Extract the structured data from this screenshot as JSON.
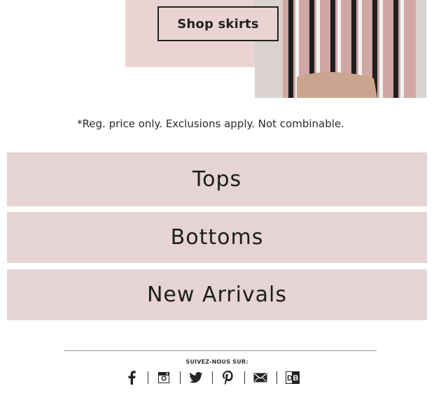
{
  "hero": {
    "button_label": "Shop skirts",
    "panel_color": "#ead4d3"
  },
  "disclaimer": "*Reg. price only. Exclusions apply. Not combinable.",
  "categories": [
    {
      "label": "Tops"
    },
    {
      "label": "Bottoms"
    },
    {
      "label": "New Arrivals"
    }
  ],
  "category_color": "#e6d3d4",
  "footer": {
    "follow_label": "SUIVEZ-NOUS SUR:",
    "social": [
      "facebook-icon",
      "instagram-icon",
      "twitter-icon",
      "pinterest-icon",
      "email-icon",
      "db-icon"
    ]
  }
}
